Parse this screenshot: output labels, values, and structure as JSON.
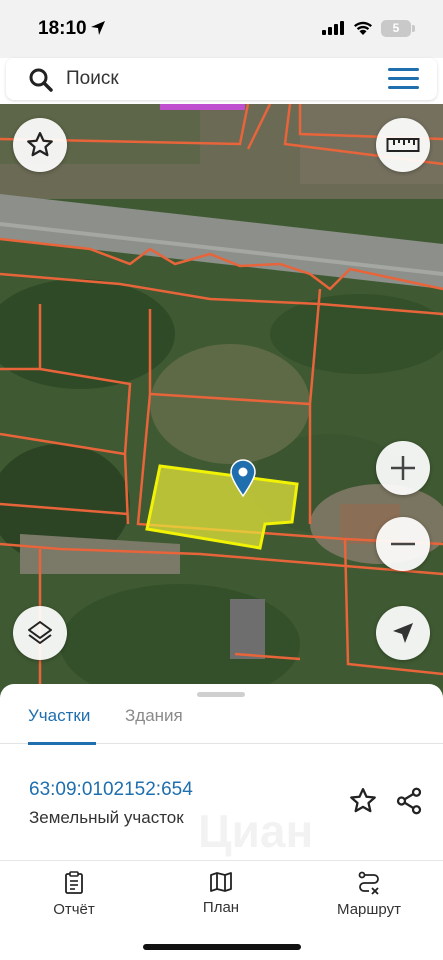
{
  "status_bar": {
    "time": "18:10",
    "battery": "5"
  },
  "search": {
    "placeholder": "Поиск"
  },
  "map": {
    "parcel_highlight_color": "#e8e83a",
    "boundary_color": "#e8643a",
    "pin_color": "#1f6fae"
  },
  "sheet": {
    "tabs": [
      {
        "label": "Участки",
        "active": true
      },
      {
        "label": "Здания",
        "active": false
      }
    ],
    "plot": {
      "cadastral_number": "63:09:0102152:654",
      "type": "Земельный участок"
    },
    "watermark": "Циан"
  },
  "bottom_nav": [
    {
      "label": "Отчёт",
      "icon": "report-icon"
    },
    {
      "label": "План",
      "icon": "map-plan-icon"
    },
    {
      "label": "Маршрут",
      "icon": "route-icon"
    }
  ],
  "colors": {
    "accent": "#1f6fae",
    "status_bg": "#f2f2f2"
  }
}
